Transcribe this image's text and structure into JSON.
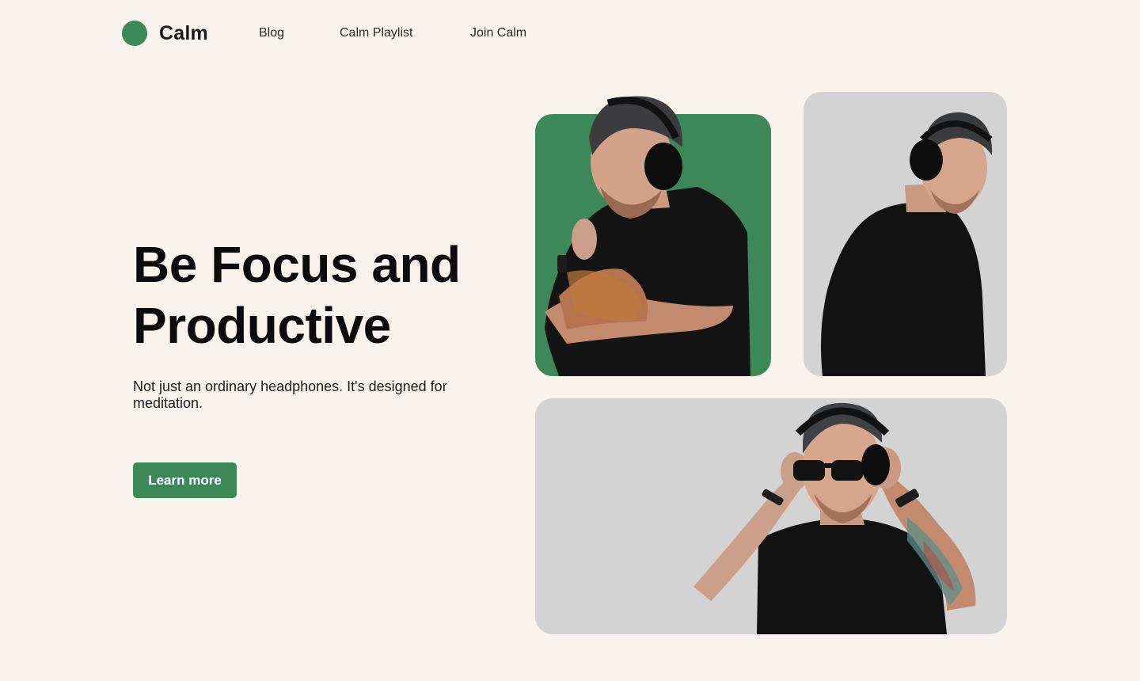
{
  "nav": {
    "brand": "Calm",
    "links": [
      {
        "label": "Blog"
      },
      {
        "label": "Calm Playlist"
      },
      {
        "label": "Join Calm"
      }
    ]
  },
  "hero": {
    "title_line1": "Be Focus and",
    "title_line2": "Productive",
    "subtitle": "Not just an ordinary headphones. It's designed for meditation.",
    "cta_label": "Learn more"
  },
  "colors": {
    "background": "#f8f4ed",
    "accent_green": "#3c8858",
    "card_gray": "#d3d3d3",
    "shirt": "#121212"
  },
  "images": [
    {
      "name": "man-headphones-arms-crossed"
    },
    {
      "name": "man-headphones-profile"
    },
    {
      "name": "man-headphones-sunglasses"
    }
  ]
}
